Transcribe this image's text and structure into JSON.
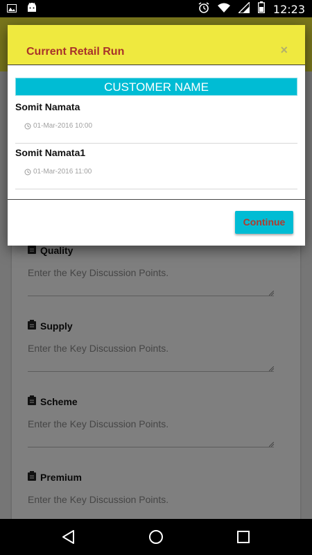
{
  "status_bar": {
    "time": "12:23",
    "icons": [
      "image-icon",
      "android-icon",
      "alarm-icon",
      "wifi-icon",
      "signal-icon",
      "battery-icon"
    ]
  },
  "dialog": {
    "title": "Current Retail Run",
    "close_label": "×",
    "column_header": "CUSTOMER NAME",
    "rows": [
      {
        "name": "Somit Namata",
        "datetime": "01-Mar-2016 10:00"
      },
      {
        "name": "Somit Namata1",
        "datetime": "01-Mar-2016 11:00"
      }
    ],
    "continue_label": "Continue"
  },
  "form": {
    "fields": [
      {
        "label": "Quality",
        "placeholder": "Enter the Key Discussion Points."
      },
      {
        "label": "Supply",
        "placeholder": "Enter the Key Discussion Points."
      },
      {
        "label": "Scheme",
        "placeholder": "Enter the Key Discussion Points."
      },
      {
        "label": "Premium",
        "placeholder": "Enter the Key Discussion Points."
      }
    ]
  },
  "colors": {
    "header_yellow": "#efe93f",
    "title_red": "#a8322a",
    "accent_cyan": "#00bcd4",
    "button_text": "#b23a2c"
  }
}
